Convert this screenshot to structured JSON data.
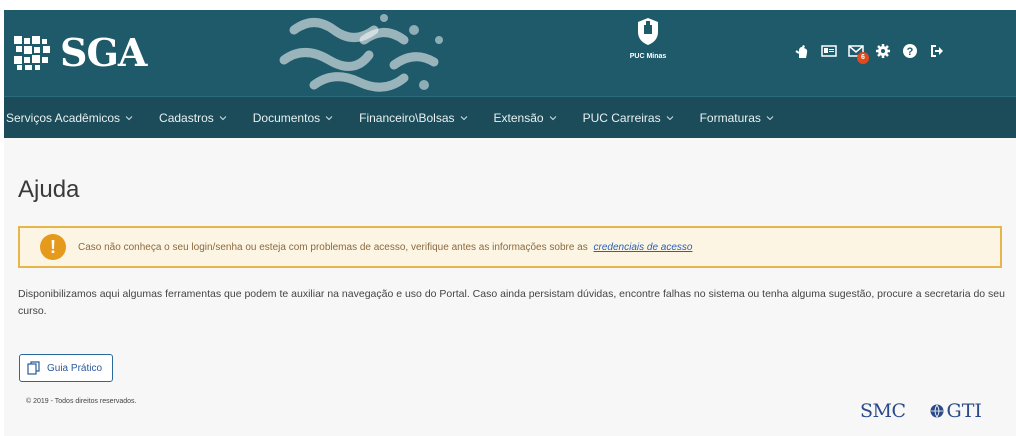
{
  "header": {
    "logo_text": "SGA",
    "institution": "PUC Minas",
    "mail_badge_count": "6",
    "tool_icons": [
      "accessibility-icon",
      "id-card-icon",
      "mail-icon",
      "gear-icon",
      "question-icon",
      "logout-icon"
    ]
  },
  "nav": {
    "items": [
      {
        "label": "Serviços Acadêmicos"
      },
      {
        "label": "Cadastros"
      },
      {
        "label": "Documentos"
      },
      {
        "label": "Financeiro\\Bolsas"
      },
      {
        "label": "Extensão"
      },
      {
        "label": "PUC Carreiras"
      },
      {
        "label": "Formaturas"
      }
    ]
  },
  "main": {
    "title": "Ajuda",
    "alert_text": "Caso não conheça o seu login/senha ou esteja com problemas de acesso, verifique antes as informações sobre as",
    "alert_link": "credenciais de acesso",
    "description": "Disponibilizamos aqui algumas ferramentas que podem te auxiliar na navegação e uso do Portal. Caso ainda persistam dúvidas, encontre falhas no sistema ou tenha alguma sugestão, procure a secretaria do seu curso.",
    "guide_button": "Guia Prático"
  },
  "footer": {
    "copyright": "© 2019 - Todos direitos reservados.",
    "smc_logo": "SMC",
    "gti_logo": "GTI"
  },
  "colors": {
    "banner": "#1f5a6a",
    "nav": "#1c4c59",
    "alert_border": "#e6b54c",
    "alert_icon": "#e69a1b",
    "link": "#2a60b8",
    "badge": "#e04a1d"
  }
}
